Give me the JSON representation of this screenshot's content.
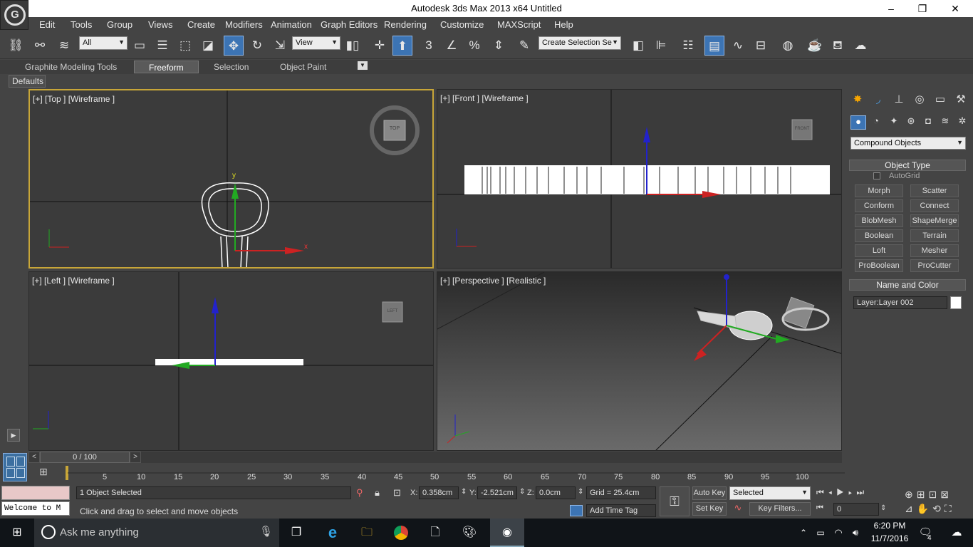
{
  "window": {
    "title": "Autodesk 3ds Max  2013 x64     Untitled",
    "minimize": "–",
    "restore": "❐",
    "close": "✕"
  },
  "menu": [
    "Edit",
    "Tools",
    "Group",
    "Views",
    "Create",
    "Modifiers",
    "Animation",
    "Graph Editors",
    "Rendering",
    "Customize",
    "MAXScript",
    "Help"
  ],
  "toolbar": {
    "selection_filter": "All",
    "ref_coord": "View",
    "named_selection": "Create Selection Se",
    "snap_3": "3",
    "snap_pct": "%"
  },
  "ribbon": {
    "tabs": [
      "Graphite Modeling Tools",
      "Freeform",
      "Selection",
      "Object Paint"
    ],
    "defaults": "Defaults"
  },
  "viewports": {
    "top": "[+] [Top ] [Wireframe ]",
    "front": "[+] [Front ] [Wireframe ]",
    "left": "[+] [Left ] [Wireframe ]",
    "perspective": "[+] [Perspective ] [Realistic ]",
    "cube_top": "TOP",
    "cube_front": "FRONT",
    "cube_left": "LEFT"
  },
  "command_panel": {
    "category": "Compound Objects",
    "object_type_title": "Object Type",
    "autogrid": "AutoGrid",
    "buttons": [
      "Morph",
      "Scatter",
      "Conform",
      "Connect",
      "BlobMesh",
      "ShapeMerge",
      "Boolean",
      "Terrain",
      "Loft",
      "Mesher",
      "ProBoolean",
      "ProCutter"
    ],
    "name_color_title": "Name and Color",
    "name_value": "Layer:Layer 002"
  },
  "timeline": {
    "frame": "0 / 100",
    "ticks": [
      "5",
      "10",
      "15",
      "20",
      "25",
      "30",
      "35",
      "40",
      "45",
      "50",
      "55",
      "60",
      "65",
      "70",
      "75",
      "80",
      "85",
      "90",
      "95",
      "100"
    ]
  },
  "status": {
    "maxscript": "Welcome to M",
    "selected_count": "1 Object Selected",
    "prompt": "Click and drag to select and move objects",
    "x_label": "X:",
    "x_value": "0.358cm",
    "y_label": "Y:",
    "y_value": "-2.521cm",
    "z_label": "Z:",
    "z_value": "0.0cm",
    "grid": "Grid = 25.4cm",
    "add_time_tag": "Add Time Tag",
    "auto_key": "Auto Key",
    "set_key": "Set Key",
    "key_mode": "Selected",
    "key_filters": "Key Filters...",
    "current_frame": "0"
  },
  "taskbar": {
    "search": "Ask me anything",
    "time": "6:20 PM",
    "date": "11/7/2016",
    "notifications": "4"
  }
}
